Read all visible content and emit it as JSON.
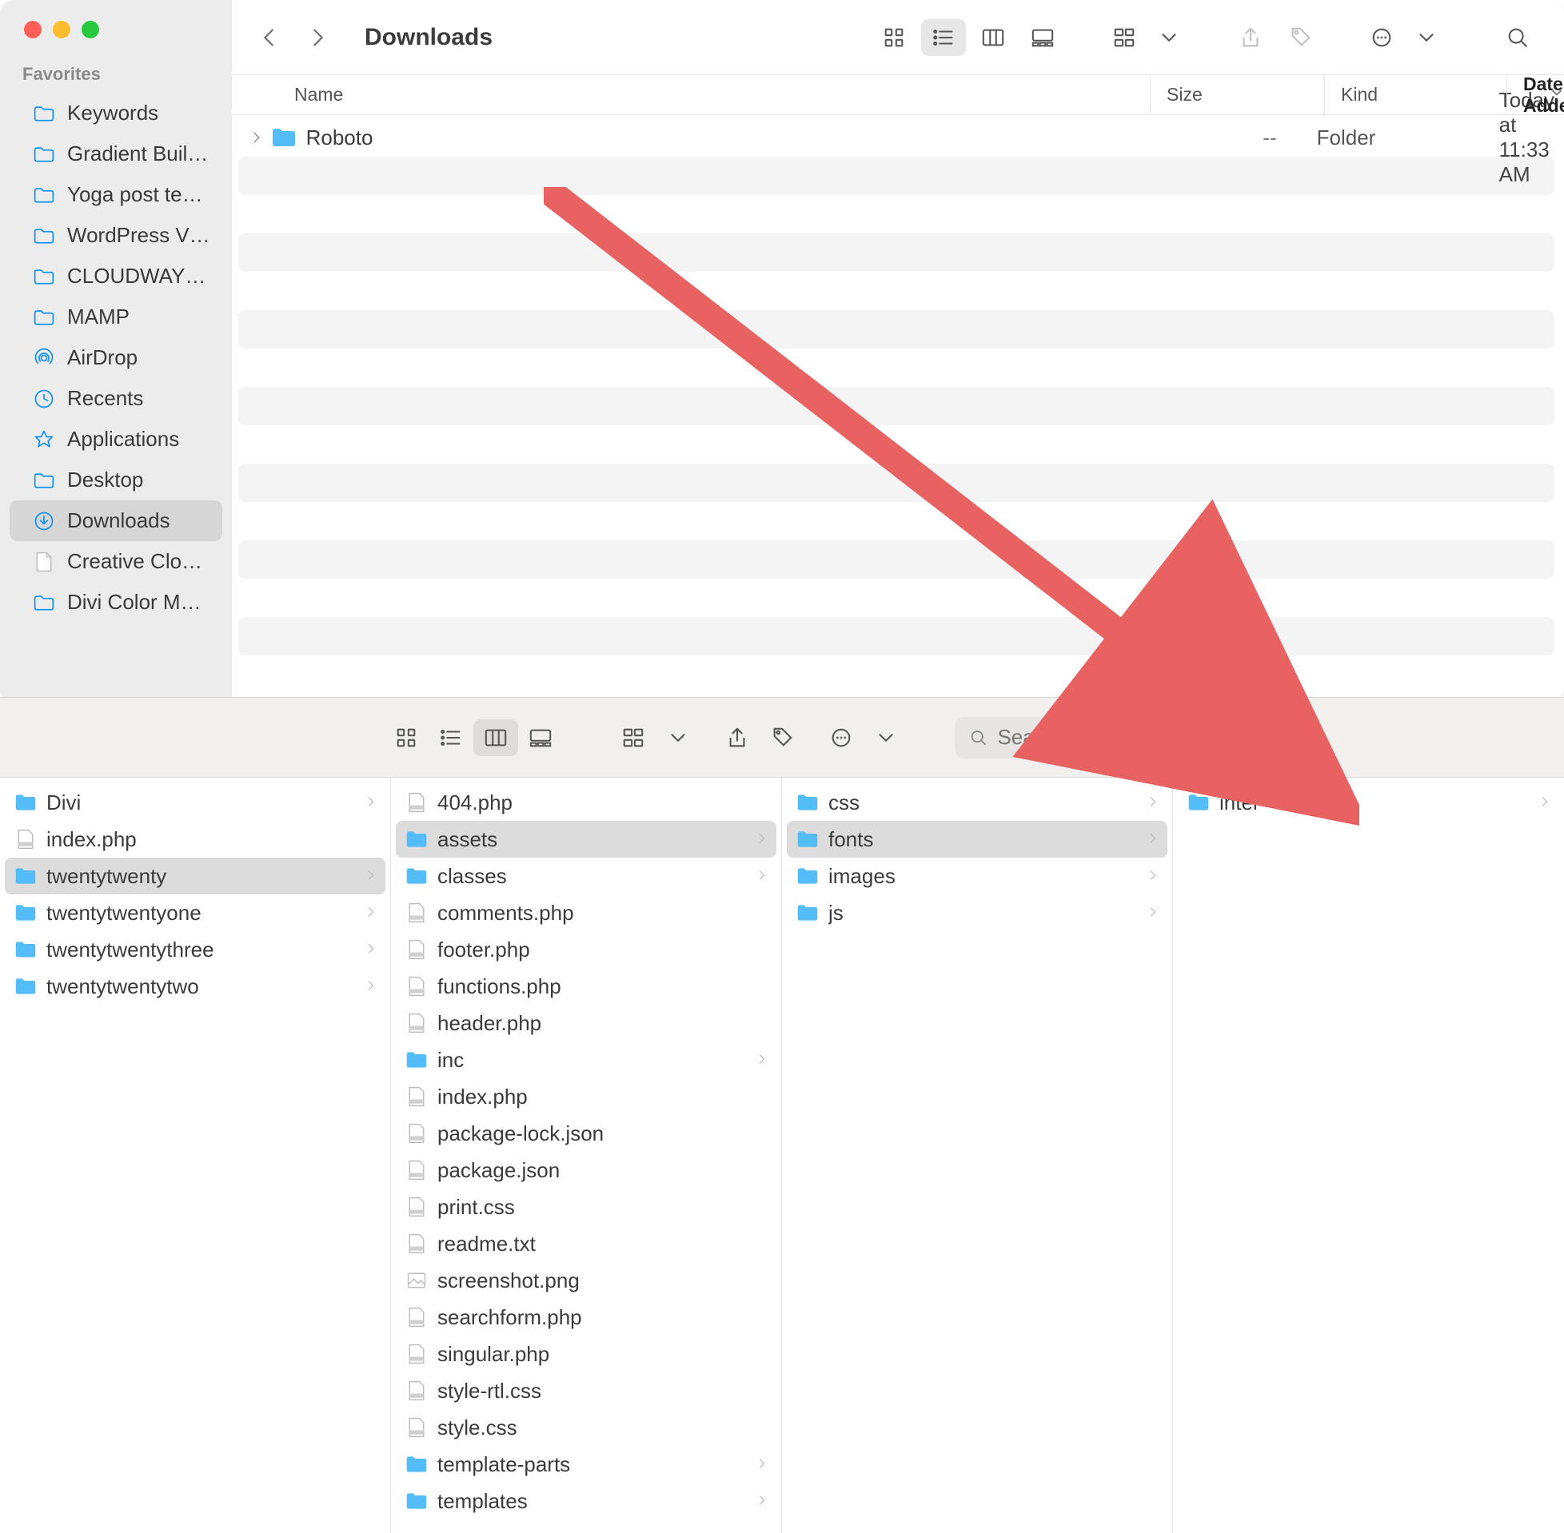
{
  "window1": {
    "title": "Downloads",
    "sidebar": {
      "header": "Favorites",
      "items": [
        {
          "label": "Keywords",
          "type": "folder",
          "selected": false
        },
        {
          "label": "Gradient Buil…",
          "type": "folder",
          "selected": false
        },
        {
          "label": "Yoga post te…",
          "type": "folder",
          "selected": false
        },
        {
          "label": "WordPress V…",
          "type": "folder",
          "selected": false
        },
        {
          "label": "CLOUDWAY…",
          "type": "folder",
          "selected": false
        },
        {
          "label": "MAMP",
          "type": "folder",
          "selected": false
        },
        {
          "label": "AirDrop",
          "type": "airdrop",
          "selected": false
        },
        {
          "label": "Recents",
          "type": "recents",
          "selected": false
        },
        {
          "label": "Applications",
          "type": "apps",
          "selected": false
        },
        {
          "label": "Desktop",
          "type": "folder",
          "selected": false
        },
        {
          "label": "Downloads",
          "type": "downloads",
          "selected": true
        },
        {
          "label": "Creative Clo…",
          "type": "doc",
          "selected": false
        },
        {
          "label": "Divi Color M…",
          "type": "folder",
          "selected": false
        }
      ]
    },
    "columns": {
      "name": "Name",
      "size": "Size",
      "kind": "Kind",
      "date_added": "Date Added"
    },
    "rows": [
      {
        "name": "Roboto",
        "size": "--",
        "kind": "Folder",
        "date_added": "Today at 11:33 AM",
        "hasChildren": true
      }
    ]
  },
  "window2": {
    "search_placeholder": "Search",
    "columns": [
      {
        "selectedIndex": 2,
        "items": [
          {
            "label": "Divi",
            "type": "folder",
            "hasChildren": true
          },
          {
            "label": "index.php",
            "type": "php"
          },
          {
            "label": "twentytwenty",
            "type": "folder",
            "hasChildren": true
          },
          {
            "label": "twentytwentyone",
            "type": "folder",
            "hasChildren": true
          },
          {
            "label": "twentytwentythree",
            "type": "folder",
            "hasChildren": true
          },
          {
            "label": "twentytwentytwo",
            "type": "folder",
            "hasChildren": true
          }
        ]
      },
      {
        "selectedIndex": 1,
        "items": [
          {
            "label": "404.php",
            "type": "php"
          },
          {
            "label": "assets",
            "type": "folder",
            "hasChildren": true
          },
          {
            "label": "classes",
            "type": "folder",
            "hasChildren": true
          },
          {
            "label": "comments.php",
            "type": "php"
          },
          {
            "label": "footer.php",
            "type": "php"
          },
          {
            "label": "functions.php",
            "type": "php"
          },
          {
            "label": "header.php",
            "type": "php"
          },
          {
            "label": "inc",
            "type": "folder",
            "hasChildren": true
          },
          {
            "label": "index.php",
            "type": "php"
          },
          {
            "label": "package-lock.json",
            "type": "file"
          },
          {
            "label": "package.json",
            "type": "file"
          },
          {
            "label": "print.css",
            "type": "css"
          },
          {
            "label": "readme.txt",
            "type": "file"
          },
          {
            "label": "screenshot.png",
            "type": "image"
          },
          {
            "label": "searchform.php",
            "type": "php"
          },
          {
            "label": "singular.php",
            "type": "php"
          },
          {
            "label": "style-rtl.css",
            "type": "css"
          },
          {
            "label": "style.css",
            "type": "css"
          },
          {
            "label": "template-parts",
            "type": "folder",
            "hasChildren": true
          },
          {
            "label": "templates",
            "type": "folder",
            "hasChildren": true
          }
        ]
      },
      {
        "selectedIndex": 1,
        "items": [
          {
            "label": "css",
            "type": "folder",
            "hasChildren": true
          },
          {
            "label": "fonts",
            "type": "folder",
            "hasChildren": true
          },
          {
            "label": "images",
            "type": "folder",
            "hasChildren": true
          },
          {
            "label": "js",
            "type": "folder",
            "hasChildren": true
          }
        ]
      },
      {
        "selectedIndex": -1,
        "items": [
          {
            "label": "inter",
            "type": "folder",
            "hasChildren": true
          }
        ]
      }
    ]
  },
  "colors": {
    "accent": "#1693f1",
    "arrow": "#e86262"
  }
}
